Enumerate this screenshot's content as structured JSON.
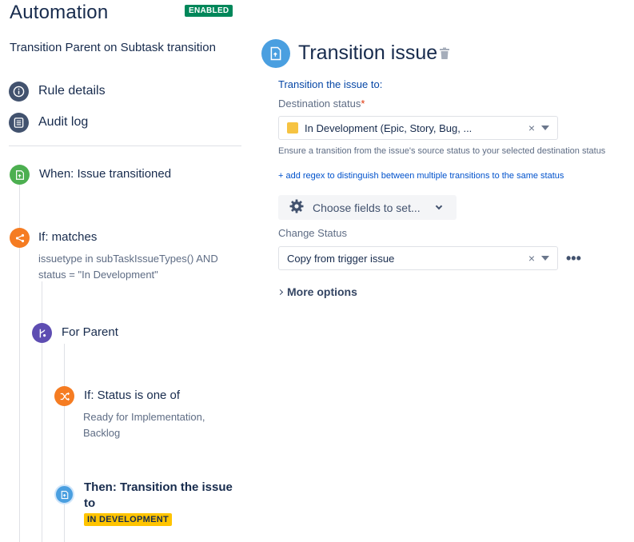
{
  "header": {
    "title": "Automation",
    "status_badge": "ENABLED"
  },
  "rule": {
    "name": "Transition Parent on Subtask transition"
  },
  "sidebar": {
    "links": [
      {
        "label": "Rule details",
        "icon": "info-icon"
      },
      {
        "label": "Audit log",
        "icon": "list-icon"
      }
    ]
  },
  "timeline": {
    "trigger": {
      "title": "When: Issue transitioned",
      "icon": "transition-trigger-icon"
    },
    "condition": {
      "title": "If: matches",
      "detail_line1": "issuetype in subTaskIssueTypes() AND",
      "detail_line2": "status = \"In Development\"",
      "icon": "branch-condition-icon"
    },
    "branch": {
      "title": "For Parent",
      "icon": "branch-icon"
    },
    "status_condition": {
      "title": "If: Status is one of",
      "detail_line1": "Ready for Implementation,",
      "detail_line2": "Backlog",
      "icon": "shuffle-icon"
    },
    "action": {
      "title_line1": "Then: Transition the issue",
      "title_line2": "to",
      "status_lozenge": "IN DEVELOPMENT",
      "icon": "transition-action-icon"
    }
  },
  "panel": {
    "title": "Transition issue",
    "transition_label": "Transition the issue to:",
    "destination_label": "Destination status",
    "required_mark": "*",
    "destination_value": "In Development (Epic, Story, Bug, ...",
    "destination_swatch_color": "#f6c342",
    "helper_text": "Ensure a transition from the issue's source status to your selected destination status",
    "regex_link": "+ add regex to distinguish between multiple transitions to the same status",
    "choose_fields_label": "Choose fields to set...",
    "change_status_label": "Change Status",
    "change_status_value": "Copy from trigger issue",
    "more_dots": "•••",
    "more_options_label": "More options",
    "clear_glyph": "×"
  }
}
